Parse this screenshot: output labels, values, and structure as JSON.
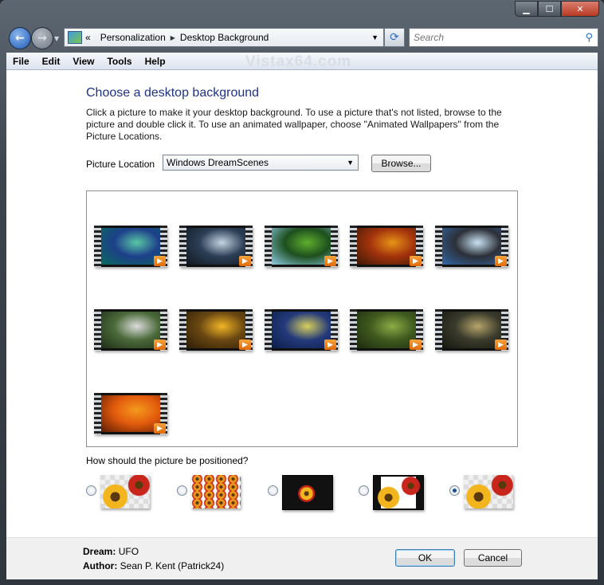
{
  "window": {
    "caption_buttons": [
      "minimize-icon",
      "maximize-icon",
      "close-icon"
    ]
  },
  "nav": {
    "breadcrumb_prefix": "«",
    "breadcrumb": [
      "Personalization",
      "Desktop Background"
    ],
    "breadcrumb_separator": "▶",
    "search_placeholder": "Search"
  },
  "menu": [
    "File",
    "Edit",
    "View",
    "Tools",
    "Help"
  ],
  "watermark": "Vistax64.com",
  "main": {
    "title": "Choose a desktop background",
    "description": "Click a picture to make it your desktop background. To use a picture that's not listed, browse to the picture and double click it. To use an animated wallpaper, choose \"Animated Wallpapers\" from the Picture Locations.",
    "location_label": "Picture Location",
    "location_value": "Windows DreamScenes",
    "browse_label": "Browse..."
  },
  "gallery": {
    "thumbnails": [
      {
        "name": "aurora",
        "colors": [
          "#0a6b5c",
          "#58c7a5",
          "#1d3f8a"
        ]
      },
      {
        "name": "ufo",
        "colors": [
          "#101820",
          "#c4d6e4",
          "#2c3f56"
        ]
      },
      {
        "name": "leaves",
        "colors": [
          "#8fcbe8",
          "#5fae2d",
          "#1d4f1e"
        ]
      },
      {
        "name": "autumn",
        "colors": [
          "#3b1806",
          "#e79317",
          "#a3330c"
        ]
      },
      {
        "name": "ice",
        "colors": [
          "#3467a6",
          "#c9e3f4",
          "#2c3038"
        ]
      },
      {
        "name": "waterfall",
        "colors": [
          "#1d2d16",
          "#dcdcdc",
          "#4b6a3a"
        ]
      },
      {
        "name": "flowers",
        "colors": [
          "#2b1c06",
          "#f1b526",
          "#6b4812"
        ]
      },
      {
        "name": "night-pond",
        "colors": [
          "#0b1e4a",
          "#d8d05c",
          "#243a7a"
        ]
      },
      {
        "name": "forest-stream",
        "colors": [
          "#1c2a0e",
          "#8cab45",
          "#3f5a1e"
        ]
      },
      {
        "name": "pillars",
        "colors": [
          "#15170f",
          "#b6a46b",
          "#3a3b2c"
        ]
      },
      {
        "name": "fire",
        "colors": [
          "#5a1a02",
          "#f49a1c",
          "#e35b0d"
        ]
      }
    ]
  },
  "position": {
    "question": "How should the picture be positioned?",
    "options": [
      "fit-to-screen",
      "tile",
      "center-on-black",
      "stretch-on-black",
      "center"
    ],
    "selected": "center"
  },
  "footer": {
    "dream_label": "Dream:",
    "dream_value": "UFO",
    "author_label": "Author:",
    "author_value": "Sean P. Kent (Patrick24)",
    "ok_label": "OK",
    "cancel_label": "Cancel"
  }
}
